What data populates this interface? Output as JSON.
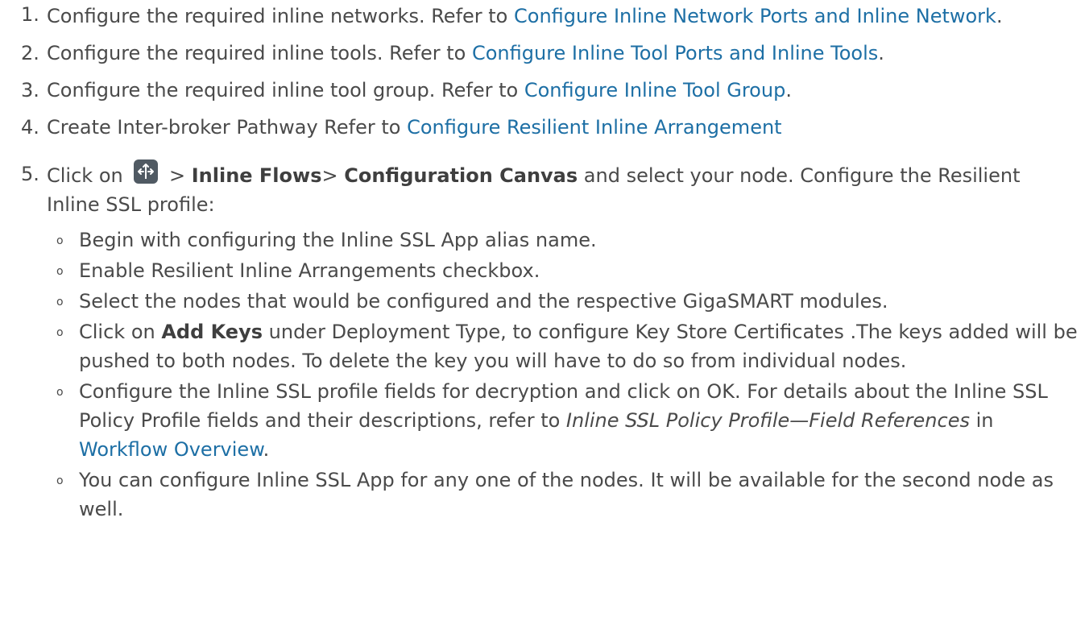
{
  "steps": [
    {
      "num": "1.",
      "text_before": "Configure the required inline networks. Refer to ",
      "link": "Configure Inline Network Ports and Inline Network",
      "text_after": "."
    },
    {
      "num": "2.",
      "text_before": "Configure the required inline tools. Refer to ",
      "link": "Configure Inline Tool Ports and Inline Tools",
      "text_after": "."
    },
    {
      "num": "3.",
      "text_before": "Configure the required inline tool group. Refer to ",
      "link": "Configure Inline Tool Group",
      "text_after": "."
    },
    {
      "num": "4.",
      "text_before": "Create Inter-broker Pathway Refer to ",
      "link": "Configure Resilient Inline Arrangement",
      "text_after": ""
    },
    {
      "num": "5.",
      "text_before": "Click on ",
      "icon": "traffic-flow-icon",
      "after_icon": " > ",
      "bold1": "Inline Flows",
      "sep": "> ",
      "bold2": "Configuration Canvas",
      "text_after": " and select your node. Configure the Resilient Inline SSL profile:",
      "sub": [
        {
          "text": "Begin with configuring the Inline SSL App alias name."
        },
        {
          "text": "Enable Resilient Inline Arrangements checkbox."
        },
        {
          "text": "Select the nodes that would be configured and the respective GigaSMART modules."
        },
        {
          "before": "Click on ",
          "bold": "Add Keys",
          "after": " under Deployment Type, to configure Key Store Certificates .The keys added will be pushed to both nodes. To delete the key you will have to do so from individual nodes."
        },
        {
          "before": "Configure the Inline SSL profile fields for decryption and click on OK. For details about the Inline SSL Policy Profile fields and their descriptions, refer to ",
          "italic": "Inline SSL Policy Profile—Field References",
          "mid": " in ",
          "link": "Workflow Overview",
          "after": "."
        },
        {
          "text": "You can configure Inline SSL App for any one of the nodes. It will be available for the second node as well."
        }
      ]
    }
  ],
  "bullet_glyph": "o",
  "colors": {
    "text": "#4a4a4a",
    "link": "#1d6fa5",
    "icon_bg": "#505a63"
  }
}
